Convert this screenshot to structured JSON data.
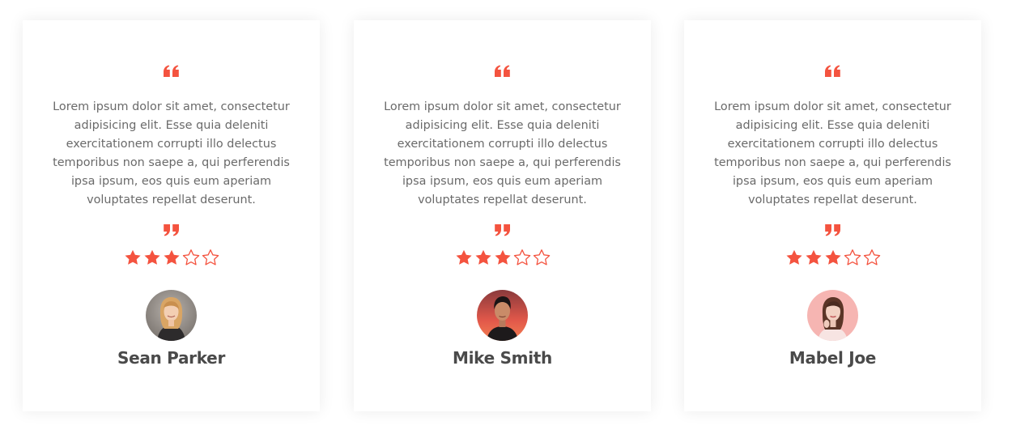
{
  "colors": {
    "accent": "#f4533f",
    "text": "#6a6a6a",
    "name": "#4a4a4a"
  },
  "testimonials": [
    {
      "text": "Lorem ipsum dolor sit amet, consectetur adipisicing elit. Esse quia deleniti exercitationem corrupti illo delectus temporibus non saepe a, qui perferendis ipsa ipsum, eos quis eum aperiam voluptates repellat deserunt.",
      "rating": 3,
      "max_rating": 5,
      "name": "Sean Parker",
      "avatar_icon": "woman-blonde-avatar"
    },
    {
      "text": "Lorem ipsum dolor sit amet, consectetur adipisicing elit. Esse quia deleniti exercitationem corrupti illo delectus temporibus non saepe a, qui perferendis ipsa ipsum, eos quis eum aperiam voluptates repellat deserunt.",
      "rating": 3,
      "max_rating": 5,
      "name": "Mike Smith",
      "avatar_icon": "man-dark-hair-avatar"
    },
    {
      "text": "Lorem ipsum dolor sit amet, consectetur adipisicing elit. Esse quia deleniti exercitationem corrupti illo delectus temporibus non saepe a, qui perferendis ipsa ipsum, eos quis eum aperiam voluptates repellat deserunt.",
      "rating": 3,
      "max_rating": 5,
      "name": "Mabel Joe",
      "avatar_icon": "woman-brunette-avatar"
    }
  ]
}
